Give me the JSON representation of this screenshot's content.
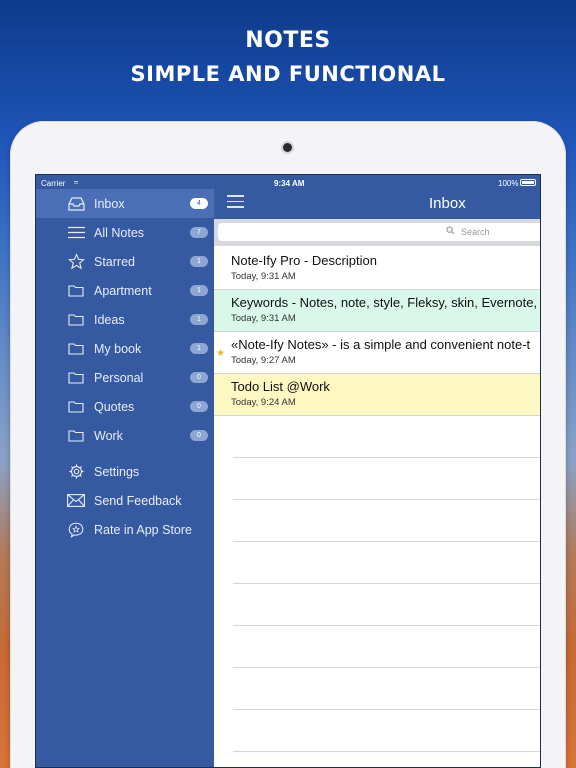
{
  "headline": {
    "line1": "NOTES",
    "line2": "SIMPLE AND FUNCTIONAL"
  },
  "status": {
    "carrier": "Carrier",
    "wifi_icon": "≈",
    "time": "9:34 AM",
    "battery": "100%"
  },
  "sidebar": {
    "items": [
      {
        "label": "Inbox",
        "count": "4",
        "icon": "inbox-icon"
      },
      {
        "label": "All Notes",
        "count": "7",
        "icon": "list-icon"
      },
      {
        "label": "Starred",
        "count": "1",
        "icon": "star-icon"
      },
      {
        "label": "Apartment",
        "count": "1",
        "icon": "folder-icon"
      },
      {
        "label": "Ideas",
        "count": "1",
        "icon": "folder-icon"
      },
      {
        "label": "My book",
        "count": "1",
        "icon": "folder-icon"
      },
      {
        "label": "Personal",
        "count": "0",
        "icon": "folder-icon"
      },
      {
        "label": "Quotes",
        "count": "0",
        "icon": "folder-icon"
      },
      {
        "label": "Work",
        "count": "0",
        "icon": "folder-icon"
      }
    ],
    "actions": [
      {
        "label": "Settings",
        "icon": "gear-icon"
      },
      {
        "label": "Send Feedback",
        "icon": "mail-icon"
      },
      {
        "label": "Rate in App Store",
        "icon": "rate-star-icon"
      }
    ]
  },
  "main": {
    "title": "Inbox",
    "search_placeholder": "Search",
    "notes": [
      {
        "title": "Note-Ify Pro - Description",
        "date": "Today, 9:31 AM",
        "color": "#ffffff",
        "starred": false
      },
      {
        "title": "Keywords - Notes, note, style, Fleksy, skin, Evernote,",
        "date": "Today, 9:31 AM",
        "color": "#d9f7ea",
        "starred": false
      },
      {
        "title": "«Note-Ify Notes» - is a simple and convenient note-t",
        "date": "Today, 9:27 AM",
        "color": "#ffffff",
        "starred": true
      },
      {
        "title": "Todo List @Work",
        "date": "Today, 9:24 AM",
        "color": "#fdf7c2",
        "starred": false
      }
    ]
  },
  "colors": {
    "sidebar": "#365aa1",
    "sidebar_active": "#4a6fb6",
    "star": "#f1b521"
  }
}
